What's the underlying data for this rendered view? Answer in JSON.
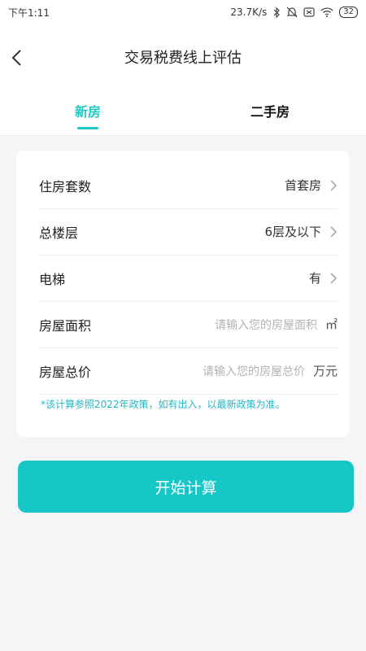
{
  "status_bar": {
    "time": "下午1:11",
    "network_speed": "23.7K/s",
    "battery": "32"
  },
  "header": {
    "title": "交易税费线上评估"
  },
  "tabs": [
    {
      "label": "新房",
      "active": true
    },
    {
      "label": "二手房",
      "active": false
    }
  ],
  "form": {
    "rows": [
      {
        "label": "住房套数",
        "value": "首套房"
      },
      {
        "label": "总楼层",
        "value": "6层及以下"
      },
      {
        "label": "电梯",
        "value": "有"
      },
      {
        "label": "房屋面积",
        "placeholder": "请输入您的房屋面积",
        "unit": "㎡"
      },
      {
        "label": "房屋总价",
        "placeholder": "请输入您的房屋总价",
        "unit": "万元"
      }
    ],
    "note": "*该计算参照2022年政策，如有出入，以最新政策为准。"
  },
  "submit_label": "开始计算",
  "colors": {
    "accent": "#1ec9c3",
    "button": "#17c7c8",
    "note": "#23b8c3"
  }
}
